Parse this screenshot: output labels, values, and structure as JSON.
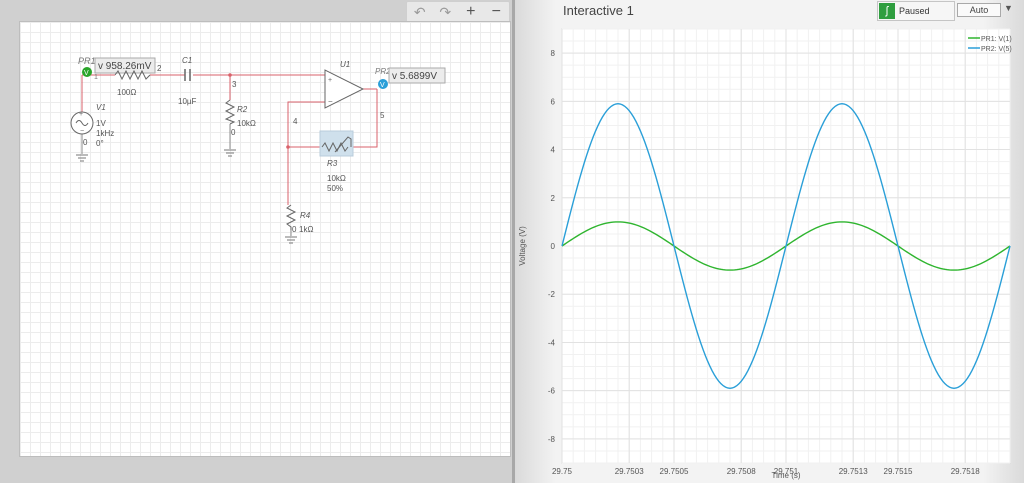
{
  "toolbar": {
    "undo_icon": "undo-icon",
    "redo_icon": "redo-icon",
    "zoom_in_label": "+",
    "zoom_out_label": "−"
  },
  "schematic": {
    "probe1": {
      "name": "PR1",
      "reading": "v 958.26mV",
      "pin_label": "1"
    },
    "probe2": {
      "name": "PR2",
      "reading": "v 5.6899V"
    },
    "v1": {
      "name": "V1",
      "amplitude": "1V",
      "frequency": "1kHz",
      "phase": "0°",
      "node": "0"
    },
    "r1": {
      "value": "100Ω"
    },
    "c1": {
      "name": "C1",
      "value": "10µF"
    },
    "r2": {
      "name": "R2",
      "value": "10kΩ",
      "node": "0"
    },
    "r3": {
      "name": "R3",
      "value": "10kΩ",
      "setting": "50%"
    },
    "r4": {
      "name": "R4",
      "value": "1kΩ",
      "node": "0"
    },
    "u1": {
      "name": "U1"
    },
    "nodes": {
      "n2": "2",
      "n3": "3",
      "n4": "4",
      "n5": "5"
    },
    "probe_badge": "V"
  },
  "grapher": {
    "title": "Interactive 1",
    "status": "Paused",
    "mode": "Auto"
  },
  "chart_data": {
    "type": "line",
    "title": "",
    "xlabel": "Time (s)",
    "ylabel": "Voltage (V)",
    "xlim": [
      29.75,
      29.752
    ],
    "ylim": [
      -9,
      9
    ],
    "x_ticks": [
      29.75,
      29.7503,
      29.7505,
      29.7508,
      29.751,
      29.7513,
      29.7515,
      29.7518
    ],
    "y_ticks": [
      8,
      6,
      4,
      2,
      0,
      -2,
      -4,
      -6,
      -8
    ],
    "grid": true,
    "legend_position": "top-right",
    "series": [
      {
        "name": "PR1: V(1)",
        "color": "#2fb52f",
        "x": [
          29.75,
          29.7501,
          29.7502,
          29.75025,
          29.7503,
          29.7504,
          29.7505,
          29.7506,
          29.7507,
          29.75075,
          29.7508,
          29.7509,
          29.751,
          29.7511,
          29.7512,
          29.75125,
          29.7513,
          29.7514,
          29.7515,
          29.7516,
          29.7517,
          29.75175,
          29.7518,
          29.7519,
          29.752
        ],
        "y": [
          0,
          0.59,
          0.95,
          1.0,
          0.95,
          0.59,
          0,
          -0.59,
          -0.95,
          -1.0,
          -0.95,
          -0.59,
          0,
          0.59,
          0.95,
          1.0,
          0.95,
          0.59,
          0,
          -0.59,
          -0.95,
          -1.0,
          -0.95,
          -0.59,
          0
        ]
      },
      {
        "name": "PR2: V(5)",
        "color": "#2a9fd8",
        "x": [
          29.75,
          29.7501,
          29.7502,
          29.75025,
          29.7503,
          29.7504,
          29.7505,
          29.7506,
          29.7507,
          29.75075,
          29.7508,
          29.7509,
          29.751,
          29.7511,
          29.7512,
          29.75125,
          29.7513,
          29.7514,
          29.7515,
          29.7516,
          29.7517,
          29.75175,
          29.7518,
          29.7519,
          29.752
        ],
        "y": [
          0,
          3.5,
          5.6,
          5.9,
          5.6,
          3.5,
          0,
          -3.5,
          -5.6,
          -5.9,
          -5.6,
          -3.5,
          0,
          3.5,
          5.6,
          5.9,
          5.6,
          3.5,
          0,
          -3.5,
          -5.6,
          -5.9,
          -5.6,
          -3.5,
          0
        ]
      }
    ]
  }
}
